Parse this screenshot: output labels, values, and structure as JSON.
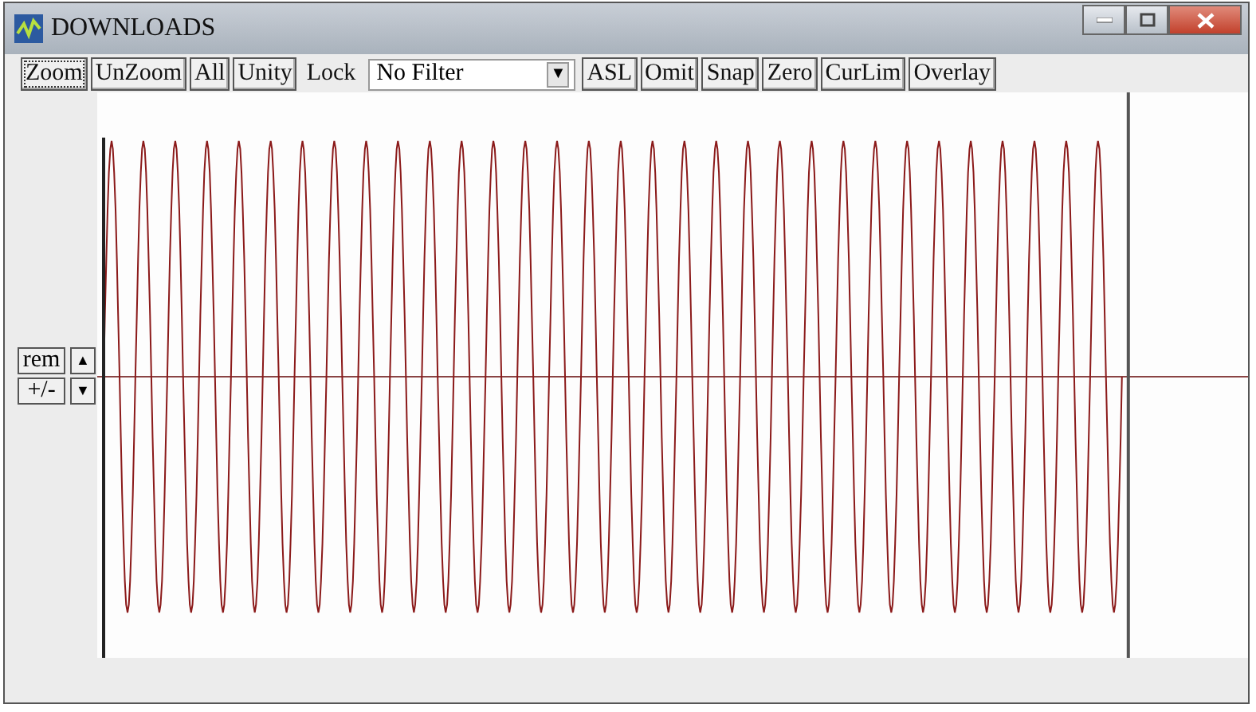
{
  "window": {
    "title": "DOWNLOADS"
  },
  "toolbar": {
    "buttons_left": [
      {
        "label": "Zoom",
        "focused": true
      },
      {
        "label": "UnZoom",
        "focused": false
      },
      {
        "label": "All",
        "focused": false
      },
      {
        "label": "Unity",
        "focused": false
      }
    ],
    "lock_label": "Lock",
    "filter": {
      "value": "No Filter",
      "arrow": "▼"
    },
    "buttons_right": [
      {
        "label": "ASL",
        "focused": false
      },
      {
        "label": "Omit",
        "focused": false
      },
      {
        "label": "Snap",
        "focused": false
      },
      {
        "label": "Zero",
        "focused": false
      },
      {
        "label": "CurLim",
        "focused": false
      },
      {
        "label": "Overlay",
        "focused": false
      }
    ]
  },
  "side_panel": {
    "buttons": [
      {
        "label": "rem",
        "arrow": "▲"
      },
      {
        "label": "+/-",
        "arrow": "▼"
      }
    ]
  }
}
